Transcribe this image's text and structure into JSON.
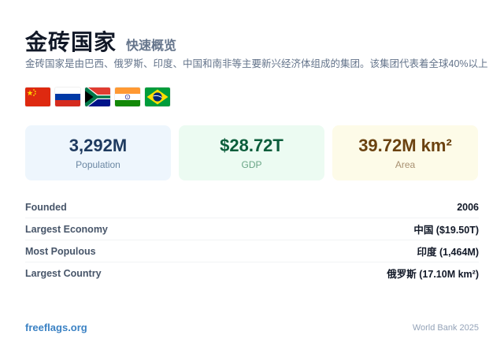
{
  "header": {
    "title": "金砖国家",
    "subtitle": "快速概览",
    "description": "金砖国家是由巴西、俄罗斯、印度、中国和南非等主要新兴经济体组成的集团。该集团代表着全球40%以上"
  },
  "flags": [
    {
      "name": "China flag",
      "icon": "flag-cn-icon"
    },
    {
      "name": "Russia flag",
      "icon": "flag-ru-icon"
    },
    {
      "name": "South Africa flag",
      "icon": "flag-za-icon"
    },
    {
      "name": "India flag",
      "icon": "flag-in-icon"
    },
    {
      "name": "Brazil flag",
      "icon": "flag-br-icon"
    }
  ],
  "stats": {
    "population": {
      "value": "3,292M",
      "label": "Population"
    },
    "gdp": {
      "value": "$28.72T",
      "label": "GDP"
    },
    "area": {
      "value": "39.72M km²",
      "label": "Area"
    }
  },
  "facts": [
    {
      "key": "Founded",
      "value": "2006"
    },
    {
      "key": "Largest Economy",
      "value": "中国 ($19.50T)"
    },
    {
      "key": "Most Populous",
      "value": "印度 (1,464M)"
    },
    {
      "key": "Largest Country",
      "value": "俄罗斯 (17.10M km²)"
    }
  ],
  "footer": {
    "site": "freeflags.org",
    "source": "World Bank 2025"
  },
  "colors": {
    "population_bg": "#eef6fd",
    "gdp_bg": "#ecfbf2",
    "area_bg": "#fdfbe8",
    "link": "#3b82c4"
  }
}
